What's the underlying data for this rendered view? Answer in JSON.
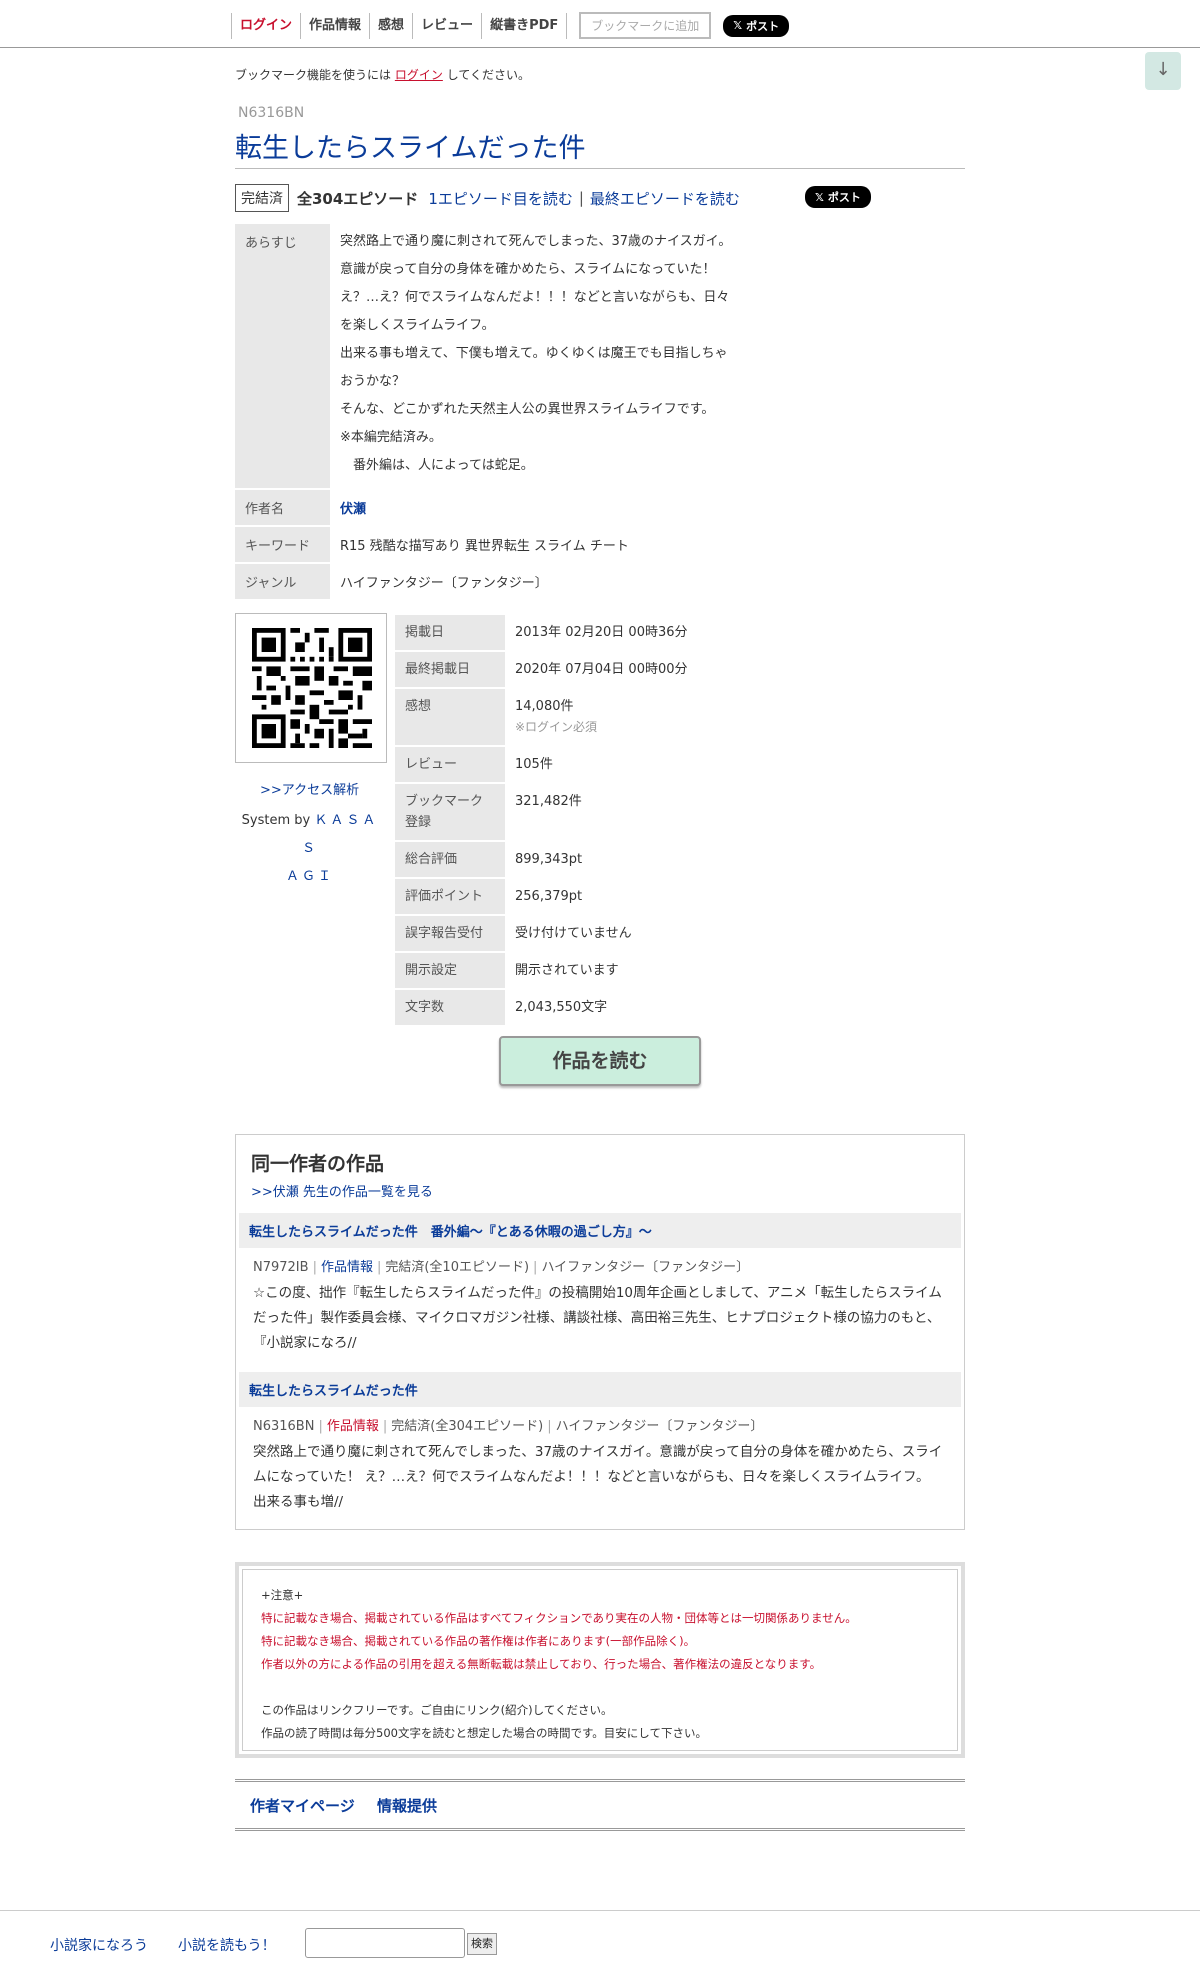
{
  "nav": {
    "login": "ログイン",
    "work_info": "作品情報",
    "impressions": "感想",
    "review": "レビュー",
    "vertical_pdf": "縦書きPDF",
    "bookmark_add": "ブックマークに追加",
    "post": "ポスト"
  },
  "scroll_down": "↓",
  "notice": {
    "prefix": "ブックマーク機能を使うには",
    "login": "ログイン",
    "suffix": "してください。"
  },
  "novel": {
    "ncode": "N6316BN",
    "title": "転生したらスライムだった件",
    "status": "完結済",
    "episodes": "全304エピソード",
    "first_ep": "1エピソード目を読む",
    "separator": "|",
    "last_ep": "最終エピソードを読む",
    "post": "ポスト"
  },
  "info": {
    "synopsis_label": "あらすじ",
    "synopsis_lines": [
      "突然路上で通り魔に刺されて死んでしまった、37歳のナイスガイ。",
      "意識が戻って自分の身体を確かめたら、スライムになっていた！",
      "え？…え？何でスライムなんだよ！！！などと言いながらも、日々",
      "を楽しくスライムライフ。",
      "出来る事も増えて、下僕も増えて。ゆくゆくは魔王でも目指しちゃ",
      "おうかな？",
      "そんな、どこかずれた天然主人公の異世界スライムライフです。",
      "※本編完結済み。",
      "　番外編は、人によっては蛇足。"
    ],
    "author_label": "作者名",
    "author": "伏瀬",
    "keyword_label": "キーワード",
    "keywords": "R15 残酷な描写あり 異世界転生 スライム チート",
    "genre_label": "ジャンル",
    "genre": "ハイファンタジー〔ファンタジー〕"
  },
  "side": {
    "access": ">>アクセス解析",
    "system_by": "System by",
    "kasasagi_1": "ＫＡＳＡＳ",
    "kasasagi_2": "ＡＧＩ"
  },
  "stats": [
    {
      "label": "掲載日",
      "value": "2013年 02月20日 00時36分",
      "note": ""
    },
    {
      "label": "最終掲載日",
      "value": "2020年 07月04日 00時00分",
      "note": ""
    },
    {
      "label": "感想",
      "value": "14,080件",
      "note": "※ログイン必須"
    },
    {
      "label": "レビュー",
      "value": "105件",
      "note": ""
    },
    {
      "label": "ブックマーク登録",
      "value": "321,482件",
      "note": ""
    },
    {
      "label": "総合評価",
      "value": "899,343pt",
      "note": ""
    },
    {
      "label": "評価ポイント",
      "value": "256,379pt",
      "note": ""
    },
    {
      "label": "誤字報告受付",
      "value": "受け付けていません",
      "note": ""
    },
    {
      "label": "開示設定",
      "value": "開示されています",
      "note": ""
    },
    {
      "label": "文字数",
      "value": "2,043,550文字",
      "note": ""
    }
  ],
  "read_button": "作品を読む",
  "same_author": {
    "heading": "同一作者の作品",
    "list_link": ">>伏瀬 先生の作品一覧を見る",
    "works": [
      {
        "title": "転生したらスライムだった件　番外編～『とある休暇の過ごし方』～",
        "ncode": "N7972IB",
        "info_link": "作品情報",
        "status": "完結済(全10エピソード)",
        "genre": "ハイファンタジー〔ファンタジー〕",
        "desc": "☆この度、拙作『転生したらスライムだった件』の投稿開始10周年企画としまして、アニメ「転生したらスライムだった件」製作委員会様、マイクロマガジン社様、講談社様、高田裕三先生、ヒナプロジェクト様の協力のもと、『小説家になろ//"
      },
      {
        "title": "転生したらスライムだった件",
        "ncode": "N6316BN",
        "info_link": "作品情報",
        "status": "完結済(全304エピソード)",
        "genre": "ハイファンタジー〔ファンタジー〕",
        "desc": "突然路上で通り魔に刺されて死んでしまった、37歳のナイスガイ。意識が戻って自分の身体を確かめたら、スライムになっていた！ え？…え？何でスライムなんだよ！！！などと言いながらも、日々を楽しくスライムライフ。 出来る事も増//"
      }
    ]
  },
  "caution": {
    "head": "+注意+",
    "red_lines": [
      "特に記載なき場合、掲載されている作品はすべてフィクションであり実在の人物・団体等とは一切関係ありません。",
      "特に記載なき場合、掲載されている作品の著作権は作者にあります(一部作品除く)。",
      "作者以外の方による作品の引用を超える無断転載は禁止しており、行った場合、著作権法の違反となります。"
    ],
    "normal_lines": [
      "この作品はリンクフリーです。ご自由にリンク(紹介)してください。",
      "作品の読了時間は毎分500文字を読むと想定した場合の時間です。目安にして下さい。"
    ]
  },
  "footer": {
    "mypage": "作者マイページ",
    "report": "情報提供"
  },
  "bottom": {
    "narou": "小説家になろう",
    "yomou": "小説を読もう！",
    "search_value": "",
    "search_button": "検索"
  }
}
